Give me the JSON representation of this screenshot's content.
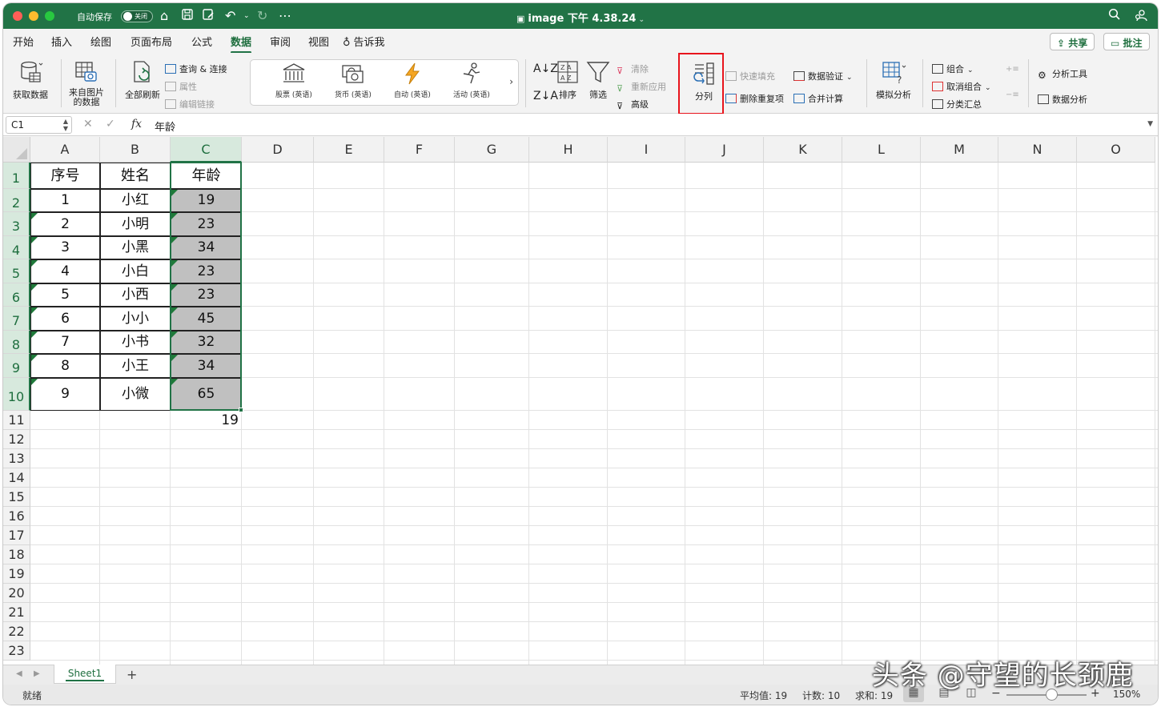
{
  "titlebar": {
    "autosave_label": "自动保存",
    "autosave_state": "关闭",
    "doc_title": "image 下午 4.38.24"
  },
  "tabs": [
    "开始",
    "插入",
    "绘图",
    "页面布局",
    "公式",
    "数据",
    "审阅",
    "视图",
    "告诉我"
  ],
  "active_tab": "数据",
  "share_label": "共享",
  "comment_label": "批注",
  "ribbon": {
    "get_data": "获取数据",
    "from_picture_1": "来自图片",
    "from_picture_2": "的数据",
    "refresh_all": "全部刷新",
    "queries_connections": "查询 & 连接",
    "properties": "属性",
    "edit_links": "编辑链接",
    "gallery": [
      "股票 (英语)",
      "货币 (英语)",
      "自动 (英语)",
      "活动 (英语)"
    ],
    "sort": "排序",
    "filter": "筛选",
    "clear": "清除",
    "reapply": "重新应用",
    "advanced": "高级",
    "text_to_columns": "分列",
    "flash_fill": "快速填充",
    "remove_duplicates": "删除重复项",
    "data_validation": "数据验证",
    "consolidate": "合并计算",
    "what_if": "模拟分析",
    "group": "组合",
    "ungroup": "取消组合",
    "subtotal": "分类汇总",
    "analysis_tools": "分析工具",
    "data_analysis": "数据分析"
  },
  "formula_bar": {
    "name_box": "C1",
    "fx": "fx",
    "content": "年龄"
  },
  "columns": [
    "A",
    "B",
    "C",
    "D",
    "E",
    "F",
    "G",
    "H",
    "I",
    "J",
    "K",
    "L",
    "M",
    "N",
    "O"
  ],
  "rows": [
    "1",
    "2",
    "3",
    "4",
    "5",
    "6",
    "7",
    "8",
    "9",
    "10",
    "11",
    "12",
    "13",
    "14",
    "15",
    "16",
    "17",
    "18",
    "19",
    "20",
    "21",
    "22",
    "23"
  ],
  "table": {
    "headers": [
      "序号",
      "姓名",
      "年龄"
    ],
    "rows": [
      [
        "1",
        "小红",
        "19"
      ],
      [
        "2",
        "小明",
        "23"
      ],
      [
        "3",
        "小黑",
        "34"
      ],
      [
        "4",
        "小白",
        "23"
      ],
      [
        "5",
        "小西",
        "23"
      ],
      [
        "6",
        "小小",
        "45"
      ],
      [
        "7",
        "小书",
        "32"
      ],
      [
        "8",
        "小王",
        "34"
      ],
      [
        "9",
        "小微",
        "65"
      ]
    ],
    "c11_value": "19"
  },
  "sheet_tab": "Sheet1",
  "status": {
    "ready": "就绪",
    "average": "平均值: 19",
    "count": "计数: 10",
    "sum": "求和: 19",
    "zoom": "150%"
  },
  "watermark": "头条 @守望的长颈鹿",
  "colors": {
    "excel_green": "#217346",
    "highlight_red": "#e8141c",
    "selection_fill": "#c0c0c0"
  }
}
